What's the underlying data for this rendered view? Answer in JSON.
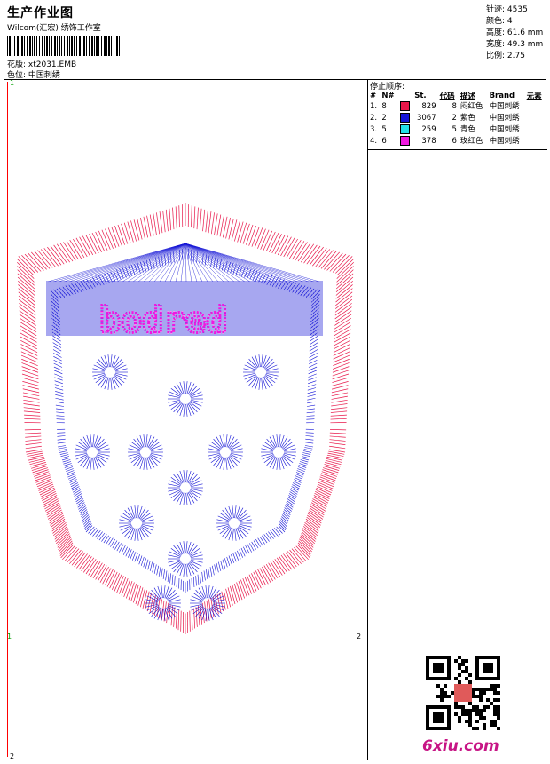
{
  "header": {
    "title": "生产作业图",
    "subtitle": "Wilcom(汇宏) 绣饰工作室",
    "design_label": "花版: xt2031.EMB",
    "color_label": "色位: 中国刺绣"
  },
  "stats": {
    "stitches": "针迹: 4535",
    "colors": "颜色: 4",
    "height": "高度: 61.6 mm",
    "width": "宽度: 49.3 mm",
    "scale": "比例: 2.75"
  },
  "sequence": {
    "title": "停止顺序:",
    "columns": [
      "#",
      "N#",
      "St.",
      "代码",
      "描述",
      "Brand",
      "元素"
    ],
    "rows": [
      {
        "idx": "1.",
        "n": "8",
        "color": "#e8174a",
        "st": "829",
        "code": "8",
        "desc": "闷红色",
        "brand": "中国刺绣"
      },
      {
        "idx": "2.",
        "n": "2",
        "color": "#1515d6",
        "st": "3067",
        "code": "2",
        "desc": "紫色",
        "brand": "中国刺绣"
      },
      {
        "idx": "3.",
        "n": "5",
        "color": "#22e0e8",
        "st": "259",
        "code": "5",
        "desc": "青色",
        "brand": "中国刺绣"
      },
      {
        "idx": "4.",
        "n": "6",
        "color": "#f018e0",
        "st": "378",
        "code": "6",
        "desc": "玫红色",
        "brand": "中国刺绣"
      }
    ]
  },
  "design": {
    "text": "bodred",
    "marker_top_left": "1",
    "marker_mid_left": "1",
    "marker_mid_right": "2",
    "marker_bottom_left": "2"
  },
  "footer": {
    "logo": "6xiu.com"
  },
  "colors": {
    "red": "#e8174a",
    "blue": "#1515d6",
    "cyan": "#22e0e8",
    "magenta": "#f018e0"
  }
}
